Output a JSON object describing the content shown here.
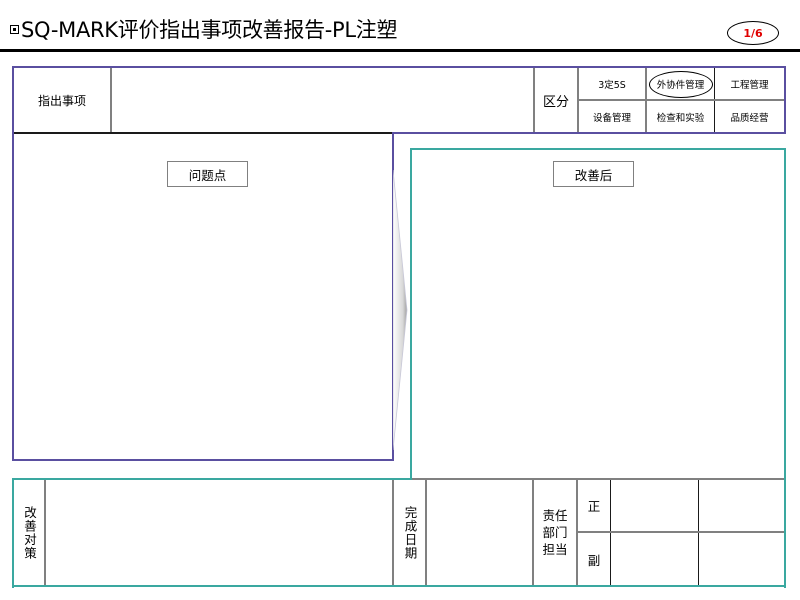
{
  "header": {
    "bullet_icon": "square-bullet",
    "title": "SQ-MARK评价指出事项改善报告-PL注塑",
    "page_indicator": "1/6",
    "page_indicator_color": "#e00000"
  },
  "top_table": {
    "item_label": "指出事项",
    "item_value": "",
    "category_label": "区分",
    "categories_row1": [
      "3定5S",
      "外协件管理",
      "工程管理"
    ],
    "categories_row2": [
      "设备管理",
      "检查和实验",
      "品质经营"
    ],
    "selected_category": "外协件管理"
  },
  "panels": {
    "problem_label": "问题点",
    "improvement_label": "改善后",
    "arrow_icon": "right-arrow-icon"
  },
  "bottom_table": {
    "countermeasure_label": "改善对策",
    "countermeasure_value": "",
    "completion_date_label": "完成日期",
    "completion_date_value": "",
    "responsible_label_line1": "责任",
    "responsible_label_line2": "部门",
    "responsible_label_line3": "担当",
    "primary_label": "正",
    "secondary_label": "副",
    "primary_dept": "",
    "primary_person": "",
    "secondary_dept": "",
    "secondary_person": ""
  },
  "colors": {
    "frame_purple": "#5a4fa0",
    "frame_teal": "#3aa8a0",
    "grid_gray": "#808080"
  }
}
